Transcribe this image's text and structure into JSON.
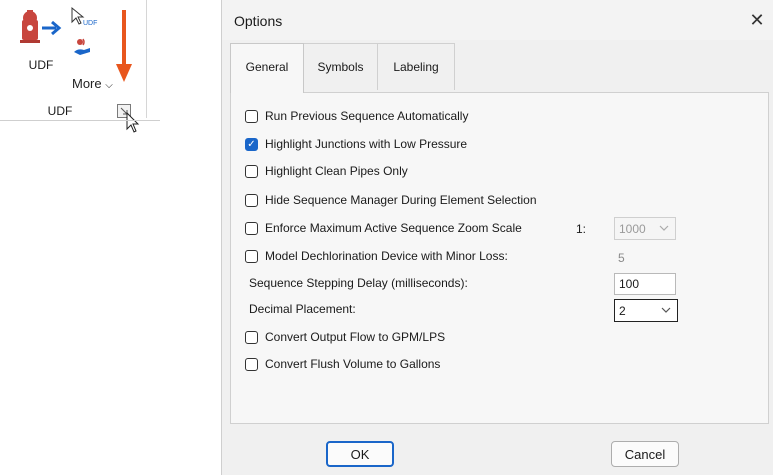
{
  "ribbon": {
    "udf_label": "UDF",
    "small_icon_label": "UDF",
    "more_label": "More",
    "group_label": "UDF"
  },
  "dialog": {
    "title": "Options",
    "tabs": [
      "General",
      "Symbols",
      "Labeling"
    ],
    "active_tab": "General",
    "options": {
      "run_previous": {
        "label": "Run Previous Sequence Automatically",
        "checked": false
      },
      "highlight_junctions": {
        "label": "Highlight Junctions with Low Pressure",
        "checked": true
      },
      "highlight_clean": {
        "label": "Highlight Clean Pipes Only",
        "checked": false
      },
      "hide_manager": {
        "label": "Hide Sequence Manager During Element Selection",
        "checked": false
      },
      "enforce_zoom": {
        "label": "Enforce Maximum Active Sequence Zoom Scale",
        "checked": false,
        "ratio_prefix": "1:",
        "value": "1000"
      },
      "model_dechlorination": {
        "label": "Model Dechlorination Device with Minor Loss:",
        "checked": false,
        "value": "5"
      },
      "stepping_delay": {
        "label": "Sequence Stepping Delay (milliseconds):",
        "value": "100"
      },
      "decimal_placement": {
        "label": "Decimal Placement:",
        "value": "2"
      },
      "convert_flow": {
        "label": "Convert Output Flow to GPM/LPS",
        "checked": false
      },
      "convert_flush": {
        "label": "Convert Flush Volume to Gallons",
        "checked": false
      }
    },
    "buttons": {
      "ok": "OK",
      "cancel": "Cancel"
    }
  },
  "colors": {
    "accent": "#1a66c9",
    "annotation_arrow": "#e8561d",
    "hydrant": "#c8463e"
  }
}
